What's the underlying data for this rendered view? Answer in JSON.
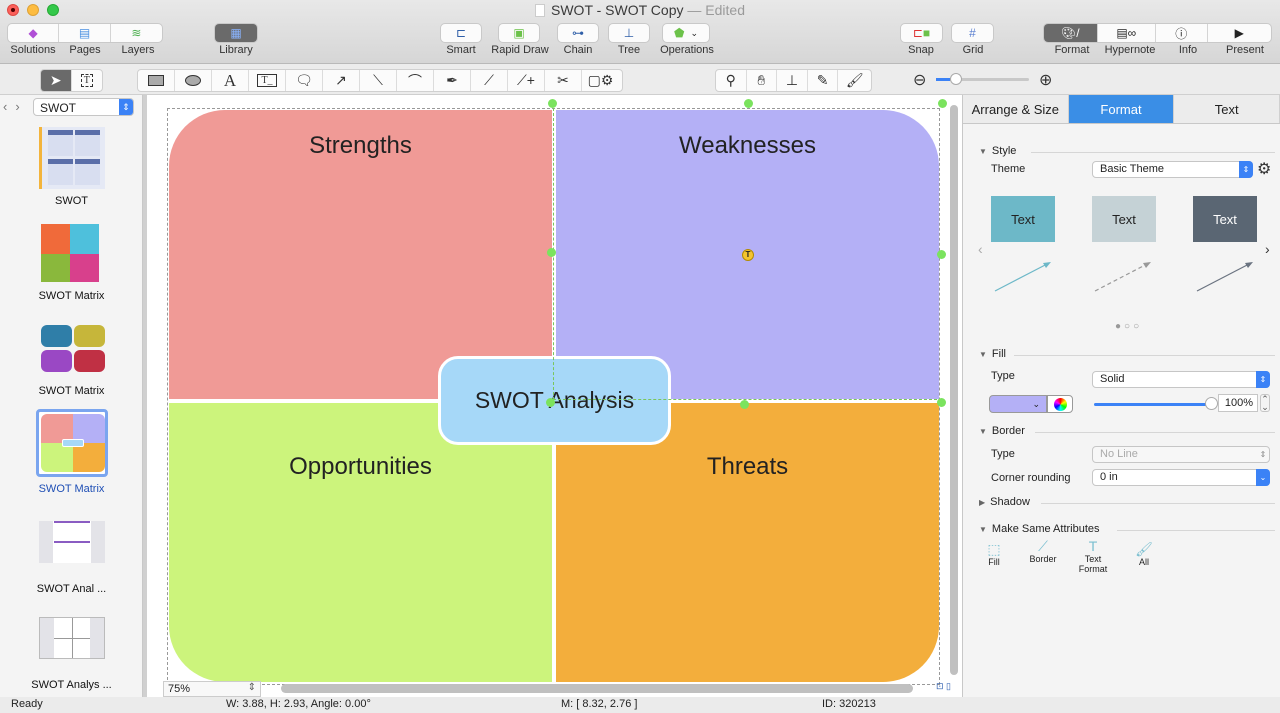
{
  "window": {
    "title": "SWOT - SWOT Copy",
    "edited": "— Edited"
  },
  "toolbar": {
    "left_group": [
      {
        "label": "Solutions",
        "icon": "solutions-icon"
      },
      {
        "label": "Pages",
        "icon": "pages-icon"
      },
      {
        "label": "Layers",
        "icon": "layers-icon"
      }
    ],
    "library": {
      "label": "Library",
      "icon": "library-icon"
    },
    "diagram_tools": [
      {
        "label": "Smart",
        "icon": "smart-icon"
      },
      {
        "label": "Rapid Draw",
        "icon": "rapid-draw-icon"
      },
      {
        "label": "Chain",
        "icon": "chain-icon"
      },
      {
        "label": "Tree",
        "icon": "tree-icon"
      },
      {
        "label": "Operations",
        "icon": "operations-icon"
      }
    ],
    "snap": {
      "label": "Snap",
      "icon": "snap-icon"
    },
    "grid": {
      "label": "Grid",
      "icon": "grid-icon"
    },
    "right_group": [
      {
        "label": "Format",
        "icon": "palette-icon",
        "active": true
      },
      {
        "label": "Hypernote",
        "icon": "hypernote-icon"
      },
      {
        "label": "Info",
        "icon": "info-icon"
      },
      {
        "label": "Present",
        "icon": "present-icon"
      }
    ]
  },
  "draw_tools": {
    "select": [
      "pointer",
      "text-select"
    ],
    "shapes": [
      "rectangle",
      "ellipse",
      "text",
      "text-box",
      "callout",
      "arrow",
      "line",
      "curve",
      "pen",
      "bezier",
      "add-point",
      "scissors",
      "shape-settings"
    ],
    "view": [
      "zoom",
      "hand",
      "stamp",
      "eyedropper",
      "brush"
    ],
    "zoom_slider_value": 0.15
  },
  "sidebar": {
    "selector": "SWOT",
    "pages": [
      {
        "label": "SWOT"
      },
      {
        "label": "SWOT Matrix"
      },
      {
        "label": "SWOT Matrix"
      },
      {
        "label": "SWOT Matrix",
        "selected": true
      },
      {
        "label": "SWOT Anal ..."
      },
      {
        "label": "SWOT Analys ..."
      }
    ]
  },
  "canvas": {
    "zoom": "75%",
    "quadrants": {
      "strengths": {
        "label": "Strengths",
        "color": "#f09a96"
      },
      "weaknesses": {
        "label": "Weaknesses",
        "color": "#b4b0f6"
      },
      "opportunities": {
        "label": "Opportunities",
        "color": "#ccf47c"
      },
      "threats": {
        "label": "Threats",
        "color": "#f3ae3c"
      }
    },
    "center": {
      "label": "SWOT Analysis",
      "color": "#a6d8f8"
    }
  },
  "format_panel": {
    "tabs": [
      "Arrange & Size",
      "Format",
      "Text"
    ],
    "active_tab": "Format",
    "style": {
      "header": "Style",
      "theme_label": "Theme",
      "theme_value": "Basic Theme",
      "swatches": [
        {
          "text": "Text",
          "color": "#6db8c8"
        },
        {
          "text": "Text",
          "color": "#c5d2d6"
        },
        {
          "text": "Text",
          "color": "#5a6673"
        }
      ],
      "page_index": 1,
      "page_count": 3
    },
    "fill": {
      "header": "Fill",
      "type_label": "Type",
      "type_value": "Solid",
      "color": "#b4b0f6",
      "opacity": "100%"
    },
    "border": {
      "header": "Border",
      "type_label": "Type",
      "type_value": "No Line",
      "corner_label": "Corner rounding",
      "corner_value": "0 in"
    },
    "shadow": {
      "header": "Shadow"
    },
    "make_same": {
      "header": "Make Same Attributes",
      "items": [
        "Fill",
        "Border",
        "Text Format",
        "All"
      ]
    }
  },
  "status": {
    "state": "Ready",
    "dims": "W: 3.88,  H: 2.93,  Angle: 0.00°",
    "mouse": "M: [ 8.32, 2.76 ]",
    "id": "ID: 320213"
  }
}
